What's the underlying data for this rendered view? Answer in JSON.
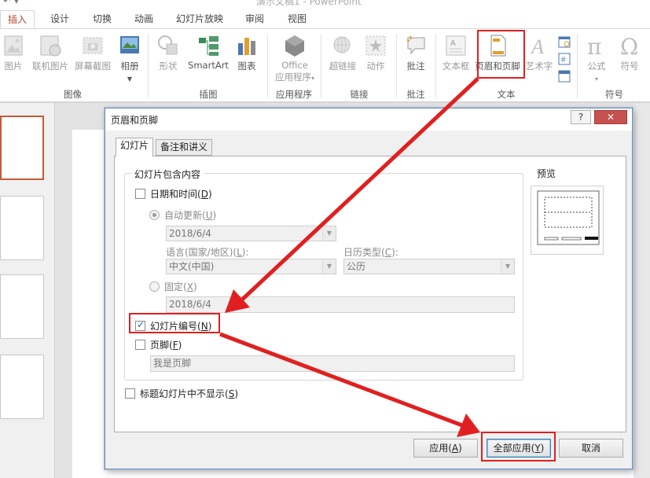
{
  "window": {
    "title_fragment": "演示文稿1 - PowerPoint"
  },
  "tabs": [
    {
      "label": "插入",
      "active": true
    },
    {
      "label": "设计"
    },
    {
      "label": "切换"
    },
    {
      "label": "动画"
    },
    {
      "label": "幻灯片放映"
    },
    {
      "label": "审阅"
    },
    {
      "label": "视图"
    }
  ],
  "ribbon": {
    "groups": {
      "images": "图像",
      "illustrations": "插图",
      "apps": "应用程序",
      "links": "链接",
      "comments": "批注",
      "text": "文本",
      "symbols": "符号"
    },
    "buttons": {
      "picture": "图片",
      "online_picture": "联机图片",
      "screenshot": "屏幕截图",
      "album": "相册",
      "shapes": "形状",
      "smartart": "SmartArt",
      "chart": "图表",
      "office_apps_1": "Office",
      "office_apps_2": "应用程序",
      "hyperlink": "超链接",
      "action": "动作",
      "comment": "批注",
      "textbox": "文本框",
      "header_footer": "页眉和页脚",
      "wordart": "艺术字",
      "equation": "公式",
      "symbol": "符号"
    }
  },
  "dialog": {
    "title": "页眉和页脚",
    "help": "?",
    "close": "✕",
    "tabs": [
      {
        "label": "幻灯片",
        "active": true
      },
      {
        "label": "备注和讲义"
      }
    ],
    "include_group": "幻灯片包含内容",
    "date_time": {
      "label": "日期和时间",
      "key": "D",
      "checked": false
    },
    "auto_update": {
      "label": "自动更新",
      "key": "U",
      "selected": true
    },
    "auto_date_value": "2018/6/4",
    "language_label": "语言(国家/地区)",
    "language_key": "L",
    "language_value": "中文(中国)",
    "calendar_label": "日历类型",
    "calendar_key": "C",
    "calendar_value": "公历",
    "fixed": {
      "label": "固定",
      "key": "X",
      "selected": false
    },
    "fixed_value": "2018/6/4",
    "slide_number": {
      "label": "幻灯片编号",
      "key": "N",
      "checked": true
    },
    "footer": {
      "label": "页脚",
      "key": "F",
      "checked": false
    },
    "footer_value": "我是页脚",
    "hide_title": {
      "label": "标题幻灯片中不显示",
      "key": "S",
      "checked": false
    },
    "preview_label": "预览",
    "buttons": {
      "apply": {
        "label": "应用",
        "key": "A"
      },
      "apply_all": {
        "label": "全部应用",
        "key": "Y"
      },
      "cancel": {
        "label": "取消"
      }
    }
  },
  "colors": {
    "accent": "#b7472a",
    "annotation": "#e02020",
    "selected_thumb": "#c65a38"
  }
}
